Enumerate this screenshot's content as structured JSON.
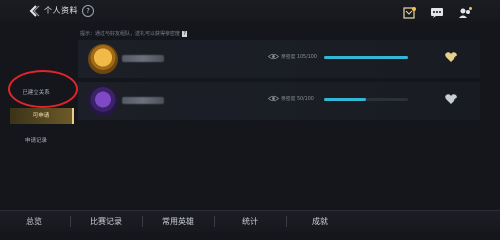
{
  "header": {
    "title": "个人资料",
    "help_icon": "?"
  },
  "notice": {
    "text": "提示：通过与好友组队，送礼可以获得亲密度",
    "help_icon": "?"
  },
  "sidebar": {
    "items": [
      {
        "label": "已建立关系"
      },
      {
        "label": "可申请"
      },
      {
        "label": "申请记录"
      }
    ]
  },
  "relations": [
    {
      "intimacy_label": "亲密度",
      "intimacy_value": "105/100",
      "progress": 1.0
    },
    {
      "intimacy_label": "亲密度",
      "intimacy_value": "50/100",
      "progress": 0.5
    }
  ],
  "tabs": [
    {
      "label": "总览"
    },
    {
      "label": "比赛记录"
    },
    {
      "label": "常用英雄"
    },
    {
      "label": "统计"
    },
    {
      "label": "成就"
    }
  ],
  "colors": {
    "accent": "#32b8d4",
    "gold": "#e7cf8a",
    "highlight": "#e2252b"
  }
}
